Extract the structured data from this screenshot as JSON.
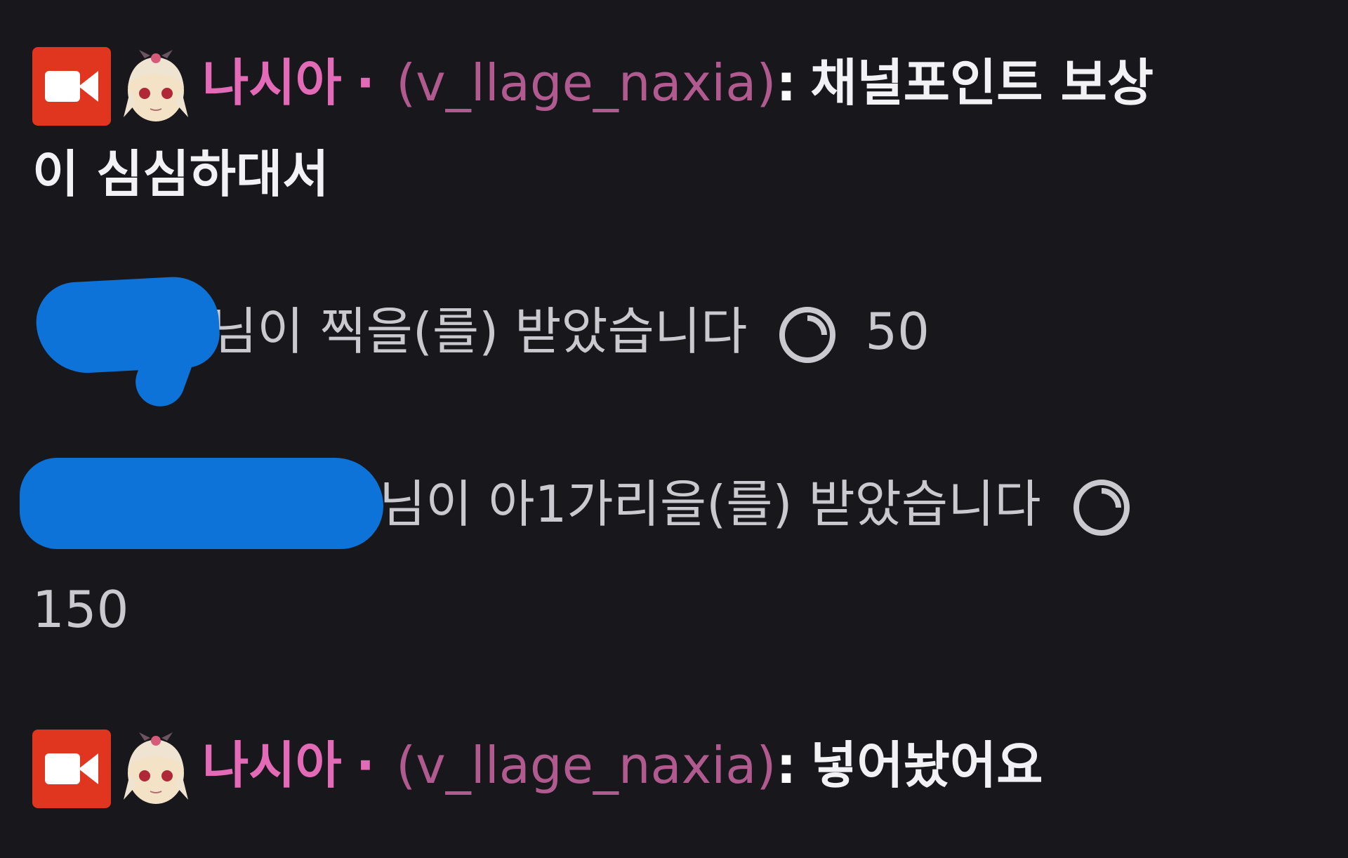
{
  "messages": [
    {
      "type": "chat",
      "badge": "broadcaster-camera-icon",
      "emote": "anime-girl-avatar-emote",
      "display_name": "나시아",
      "separator": "·",
      "login": "(v_llage_naxia)",
      "colon": ":",
      "text_line1": "채널포인트 보상",
      "text_line2": "이 심심하대서"
    },
    {
      "type": "redemption",
      "user_redacted": true,
      "text": "님이 찍을(를) 받았습니다",
      "icon": "channel-points-icon",
      "points": "50"
    },
    {
      "type": "redemption",
      "user_redacted": true,
      "text": "님이 아1가리을(를) 받았습니다",
      "icon": "channel-points-icon",
      "points": "150"
    },
    {
      "type": "chat",
      "badge": "broadcaster-camera-icon",
      "emote": "anime-girl-avatar-emote",
      "display_name": "나시아",
      "separator": "·",
      "login": "(v_llage_naxia)",
      "colon": ":",
      "text_line1": "넣어놨어요"
    }
  ],
  "colors": {
    "background": "#18171c",
    "display_name": "#e36ab6",
    "login": "#b05a8f",
    "badge_red": "#e0351f",
    "redaction_blue": "#0d73d9"
  }
}
